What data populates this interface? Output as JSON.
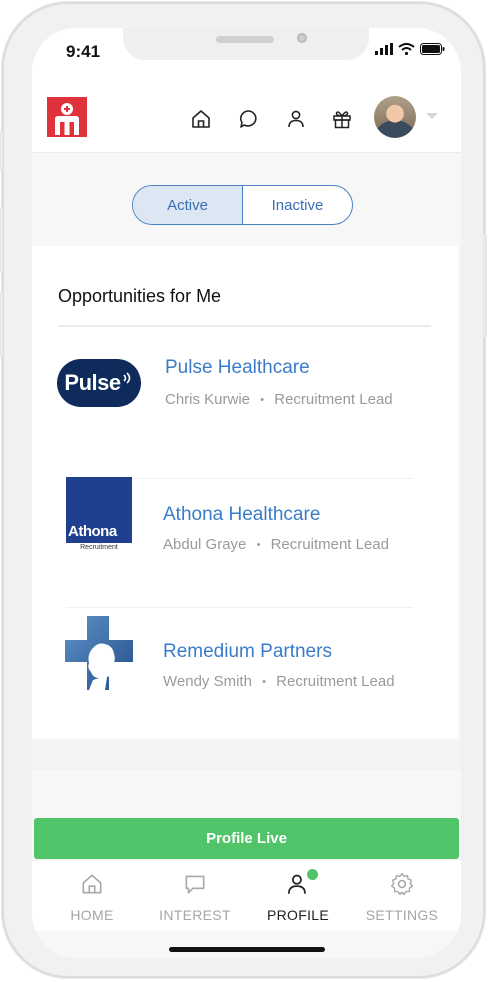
{
  "status_bar": {
    "time": "9:41"
  },
  "header": {
    "brand_logo": "medic-logo",
    "nav_icons": [
      "home-icon",
      "chat-icon",
      "user-icon",
      "gift-icon"
    ],
    "avatar": "profile-avatar"
  },
  "filter_toggle": {
    "active_label": "Active",
    "inactive_label": "Inactive",
    "selected": "Active"
  },
  "opportunities": {
    "title": "Opportunities for Me",
    "items": [
      {
        "company": "Pulse Healthcare",
        "contact": "Chris Kurwie",
        "role": "Recruitment Lead",
        "logo_text": "Pulse"
      },
      {
        "company": "Athona Healthcare",
        "contact": "Abdul Graye",
        "role": "Recruitment Lead",
        "logo_text": "Athona",
        "logo_subtext": "Recruitment"
      },
      {
        "company": "Remedium Partners",
        "contact": "Wendy Smith",
        "role": "Recruitment Lead"
      }
    ],
    "separator": "•"
  },
  "cta": {
    "label": "Profile Live"
  },
  "tab_bar": {
    "tabs": [
      {
        "label": "HOME",
        "icon": "home-icon"
      },
      {
        "label": "INTEREST",
        "icon": "chat-icon"
      },
      {
        "label": "PROFILE",
        "icon": "profile-icon",
        "active": true
      },
      {
        "label": "SETTINGS",
        "icon": "gear-icon"
      }
    ]
  },
  "colors": {
    "accent_blue": "#3a7cc9",
    "live_green": "#51c46a",
    "brand_red": "#e0323a",
    "pulse_navy": "#0e2b5c",
    "athona_blue": "#1f3f8f"
  }
}
